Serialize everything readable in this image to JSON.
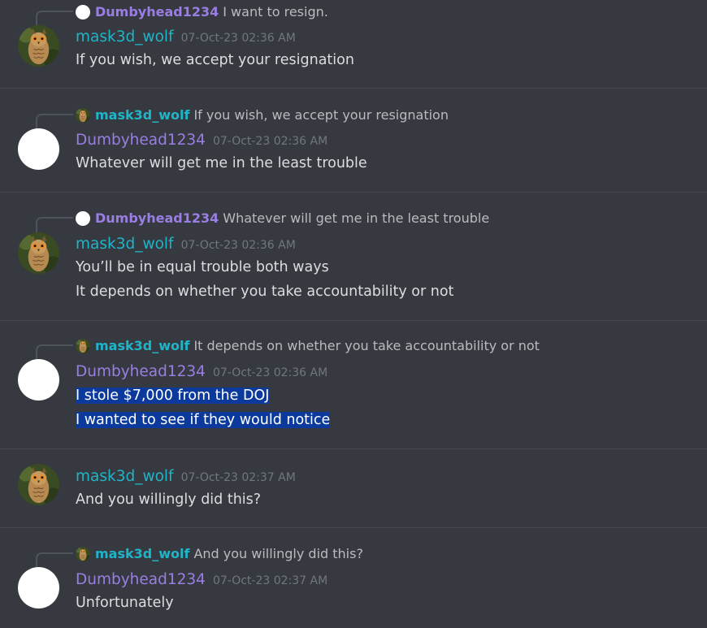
{
  "users": {
    "wolf": {
      "name": "mask3d_wolf",
      "color": "#1fb5c9",
      "avatar": "owl-photo"
    },
    "dumb": {
      "name": "Dumbyhead1234",
      "color": "#9b7ee3",
      "avatar": "white-circle"
    }
  },
  "messages": [
    {
      "reply": {
        "author": "Dumbyhead1234",
        "text": "I want to resign."
      },
      "author": "mask3d_wolf",
      "timestamp": "07-Oct-23 02:36 AM",
      "lines": [
        "If you wish, we accept your resignation"
      ]
    },
    {
      "reply": {
        "author": "mask3d_wolf",
        "text": "If you wish, we accept your resignation"
      },
      "author": "Dumbyhead1234",
      "timestamp": "07-Oct-23 02:36 AM",
      "lines": [
        "Whatever will get me in the least trouble"
      ]
    },
    {
      "reply": {
        "author": "Dumbyhead1234",
        "text": "Whatever will get me in the least trouble"
      },
      "author": "mask3d_wolf",
      "timestamp": "07-Oct-23 02:36 AM",
      "lines": [
        "You’ll be in equal trouble both ways",
        "It depends on whether you take accountability or not"
      ]
    },
    {
      "reply": {
        "author": "mask3d_wolf",
        "text": "It depends on whether you take accountability or not"
      },
      "author": "Dumbyhead1234",
      "timestamp": "07-Oct-23 02:36 AM",
      "lines": [
        "I stole $7,000 from the DOJ",
        "I wanted to see if they would notice"
      ],
      "selected": true
    },
    {
      "author": "mask3d_wolf",
      "timestamp": "07-Oct-23 02:37 AM",
      "lines": [
        "And you willingly did this?"
      ]
    },
    {
      "reply": {
        "author": "mask3d_wolf",
        "text": "And you willingly did this?"
      },
      "author": "Dumbyhead1234",
      "timestamp": "07-Oct-23 02:37 AM",
      "lines": [
        "Unfortunately"
      ]
    }
  ]
}
